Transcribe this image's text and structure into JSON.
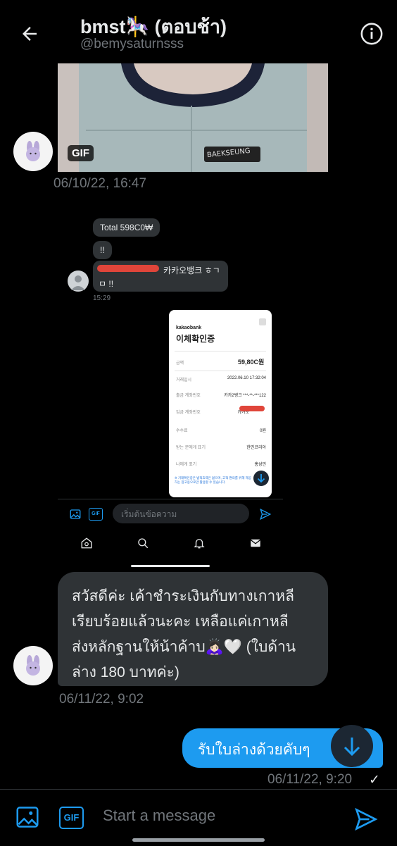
{
  "header": {
    "title": "bmst🎠 (ตอบช้า)",
    "handle": "@bemysaturnsss"
  },
  "gif_message": {
    "gif_label": "GIF",
    "badge_text": "BAEKSEUNG",
    "timestamp": "06/10/22, 16:47"
  },
  "screenshot": {
    "messages": [
      "Total 598C0₩",
      "!!",
      "카카오뱅크 ㅎㄱ",
      "ㅁ !!"
    ],
    "time": "15:29",
    "bank": {
      "brand": "kakaobank",
      "title": "이체확인증",
      "amount": "59,80C원",
      "rows": [
        {
          "label": "거래일시",
          "value": "2022.06.10 17:32:04"
        },
        {
          "label": "출금 계좌번호",
          "value": "카카2뱅크 ***-**-***122"
        },
        {
          "label": "입금 계좌번호",
          "value": "카카오"
        },
        {
          "label": "수수료",
          "value": "0원"
        },
        {
          "label": "받는 분에게 표기",
          "value": "한민코리아"
        },
        {
          "label": "나에게 표기",
          "value": "홍성민"
        }
      ],
      "note": "※ 거래확인증은 법적효력은 없으며, 고객 편의를 위해 제공하는 참고용으로만 활용할 수 있습니다."
    },
    "composer_placeholder": "เริ่มต้นข้อความ",
    "gif_label": "GIF"
  },
  "thai_message": {
    "lines": [
      "สวัสดีค่ะ เค้าชำระเงินกับทางเกาหลี",
      "เรียบร้อยแล้วนะคะ เหลือแค่เกาหลี",
      "ส่งหลักฐานให้น้าค้าบ🙇🏻‍♀️🤍 (ใบด้าน",
      "ล่าง 180 บาทค่ะ)"
    ],
    "timestamp": "06/11/22, 9:02"
  },
  "sent_message": {
    "text": "รับใบล่างด้วยคับๆ",
    "timestamp": "06/11/22, 9:20",
    "status": "✓"
  },
  "composer": {
    "placeholder": "Start a message",
    "gif_label": "GIF"
  },
  "colors": {
    "accent": "#1d9bf0",
    "bubble_received": "#2f3336",
    "muted": "#71767b"
  }
}
